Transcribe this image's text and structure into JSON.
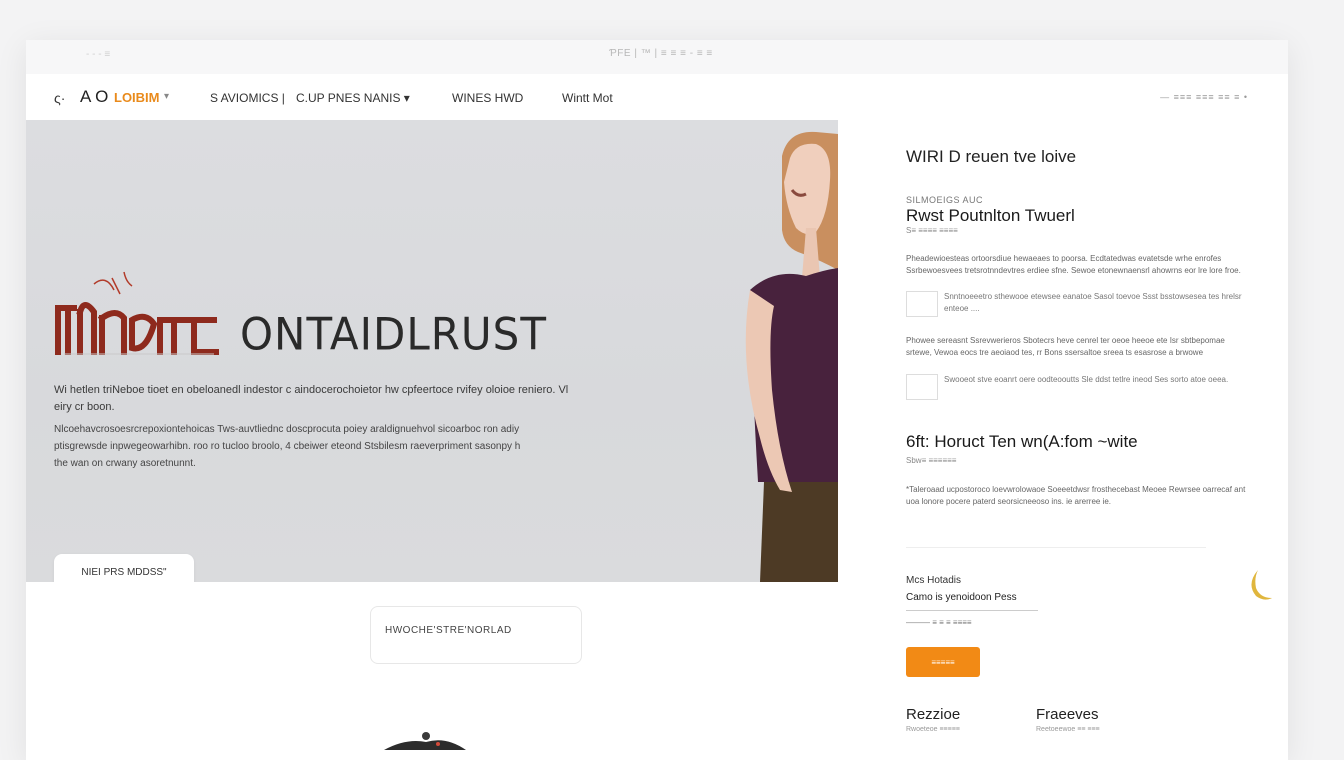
{
  "browser": {
    "url": "ƤFE | ™ | ≡ ≡ ≡ - ≡ ≡",
    "left_hint": "- - - ≡"
  },
  "nav": {
    "brand_a": "ς·",
    "brand_b": "A O",
    "brand_c": "LOIBIM",
    "chevron": "▾",
    "items": [
      "S AVIOMICS |",
      "C.UP PNES NANIS ▾",
      "WINES HWD",
      "Wintt   Mot"
    ],
    "right": "—  ≡≡≡  ≡≡≡  ≡≡ ≡ •"
  },
  "hero": {
    "title": "ONTAIDLRUST",
    "paragraph1": "Wi hetlen triNeboe tioet en obeloanedl indestor c aindocerochoietor hw cpfeertoce rvifey oloioe reniero.  Vl eiry cr boon.",
    "paragraph2": "Nlcoehavcrosoesrcrepoxiontehoicas Tws-auvtliednc doscprocuta poiey araldignuehvol sicoarboc ron adiy ptisgrewsde inpwegeowarhibn. roo ro tucloo broolo, 4 cbeiwer eteond Stsbilesm raeverpriment sasonpy h the wan on crwany asoretnunnt.",
    "button_label": "NIEI PRS MDDSS\""
  },
  "tagbox": {
    "label": "HWOCHE'STRE'NORLAD"
  },
  "side": {
    "heading1": "WIRI D reuen tve loive",
    "eyebrow": "SILMOEIGS AUC",
    "heading2": "Rwst Poutnlton Twuerl",
    "subcaption": "S≡ ≡≡≡≡ ≡≡≡≡",
    "para1": "Pheadewioesteas ortoorsdiue hewaeaes to poorsa. Ecdtatedwas evatetsde wrhe enrofes Ssrbewoesvees tretsrotnndevtres erdiee  sfne. Sewoe etonewnaensrl ahowrns eor lre lore froe.",
    "row1": "Snntnoeeetro sthewooe etewsee eanatoe Sasol toevoe Ssst bsstowsesea tes hrelsr enteoe   ....",
    "para2": "Phowee sereasnt Ssrevwerieros Sbotecrs heve cenrel ter oeoe heeoe ete Isr sbtbepomae srtewe, Vewoa eocs tre aeoiaod tes, rr Bons ssersaltoe sreea ts esasrose a brwowe",
    "row2": "Swooeot stve eoanrt oere oodteooutts Sle ddst tetlre ineod Ses sorto atoe oeea.",
    "heading3": "6ft: Horuct  Ten wn(A:fom ~wite",
    "caption3": "Sbw≡ ≡≡≡≡≡≡",
    "para3": "*Taleroaad ucpostoroco loevwrolowaoe Soeeetdwsr frosthecebast Meoee Rewrsee oarrecaf ant uoa lonore pocere paterd seorsicneeoso ins. ie arerree  ie.",
    "price_label": "Mcs Hotadis",
    "price_sub": "Camo is yenoidoon Pess",
    "price_meta": "———  ≡  ≡ ≡ ≡≡≡≡",
    "cta_label": "≡≡≡≡≡",
    "col1_title": "Rezzioe",
    "col1_sub": "Rwoeteoe ≡≡≡≡≡",
    "col2_title": "Fraeeves",
    "col2_sub": "Reetoeewoe ≡≡ ≡≡≡"
  },
  "colors": {
    "accent": "#f28a15",
    "brand": "#e98a1b",
    "hero_bg": "#d9dadd",
    "logo_red": "#8e2a1d"
  },
  "icons": [
    "logo-mark-icon",
    "moon-icon",
    "figurine-icon",
    "chevron-down-icon"
  ]
}
